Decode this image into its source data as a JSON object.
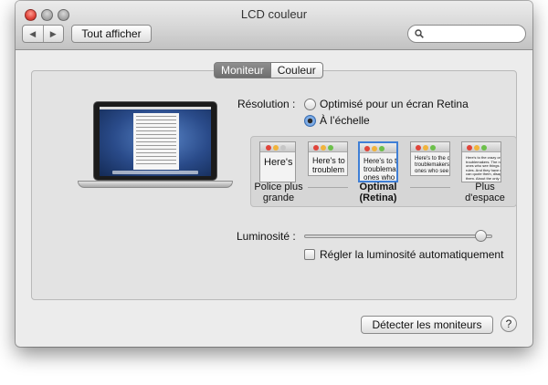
{
  "window": {
    "title": "LCD couleur",
    "toolbar": {
      "back_icon": "chevron-left-icon",
      "forward_icon": "chevron-right-icon",
      "show_all_label": "Tout afficher",
      "search_placeholder": "",
      "search_icon": "search-icon"
    }
  },
  "tabs": [
    {
      "label": "Moniteur",
      "selected": true
    },
    {
      "label": "Couleur",
      "selected": false
    }
  ],
  "resolution": {
    "label": "Résolution :",
    "options": [
      {
        "label": "Optimisé pour un écran Retina",
        "selected": false
      },
      {
        "label": "À l’échelle",
        "selected": true
      }
    ],
    "scale_options": [
      {
        "label": "Police plus grande",
        "preview_text": "Here's",
        "selected": false
      },
      {
        "label": "",
        "preview_text": "Here's to\ntroublem",
        "selected": false
      },
      {
        "label": "Optimal (Retina)",
        "preview_text": "Here's to th\ntroublemake\nones who se",
        "selected": true
      },
      {
        "label": "",
        "preview_text": "Here's to the c\ntroublemakers.\nones who see t\nrules. And they",
        "selected": false
      },
      {
        "label": "Plus d'espace",
        "preview_text": "Here's to the crazy one\ntroublemakers. The rou\nones who see things di\nrules. And they have no\ncan quote them, disagr\nthem. About the only th\nBecause they change th",
        "selected": false
      }
    ]
  },
  "brightness": {
    "label": "Luminosité :",
    "level": 0.97,
    "auto_label": "Régler la luminosité automatiquement",
    "auto_checked": false
  },
  "footer": {
    "detect_label": "Détecter les moniteurs",
    "help_label": "?"
  },
  "colors": {
    "accent": "#3f7fd6",
    "close": "#e0443a"
  }
}
